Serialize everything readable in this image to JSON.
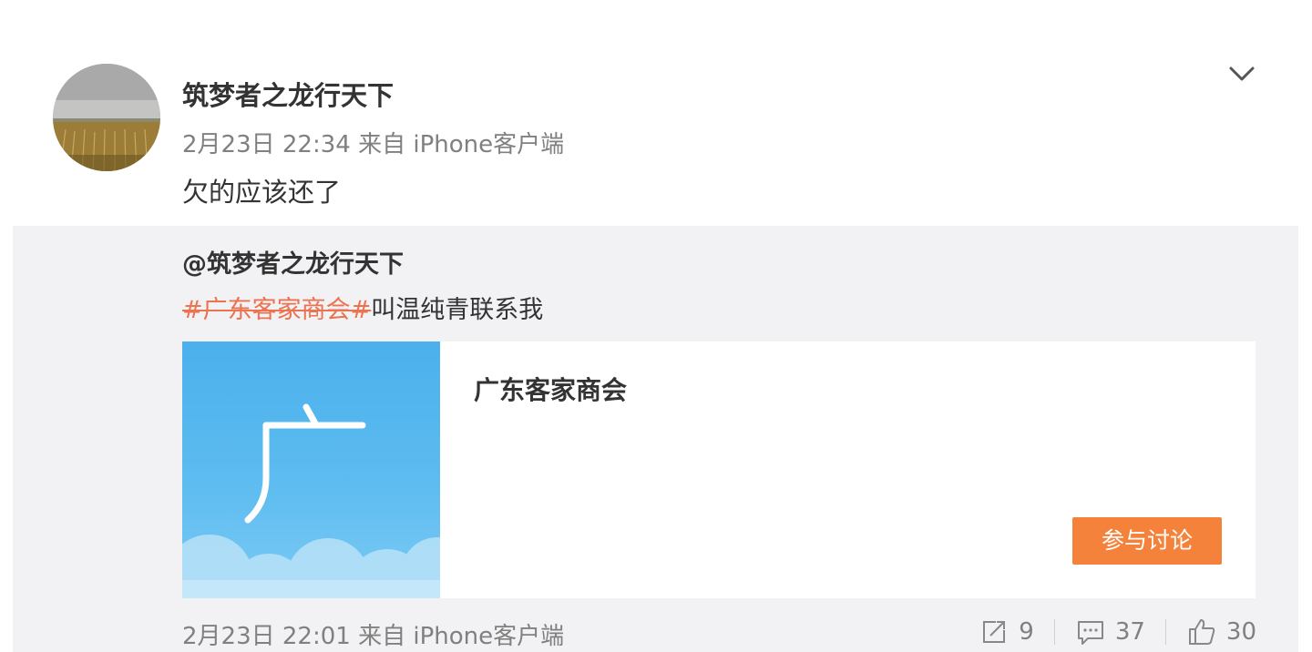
{
  "post": {
    "author": "筑梦者之龙行天下",
    "meta": "2月23日 22:34 来自 iPhone客户端",
    "text": "欠的应该还了"
  },
  "repost": {
    "author": "@筑梦者之龙行天下",
    "hashtag": "#广东客家商会#",
    "text": "叫温纯青联系我",
    "card": {
      "title": "广东客家商会",
      "image_glyph": "广",
      "button_label": "参与讨论"
    },
    "meta": "2月23日 22:01 来自 iPhone客户端",
    "actions": {
      "repost_count": "9",
      "comment_count": "37",
      "like_count": "30"
    }
  },
  "colors": {
    "hashtag": "#eb7350",
    "button": "#f5823a",
    "repost_bg": "#f2f2f5",
    "muted": "#808080"
  },
  "icons": [
    "chevron-down-icon",
    "repost-icon",
    "comment-icon",
    "like-icon"
  ]
}
